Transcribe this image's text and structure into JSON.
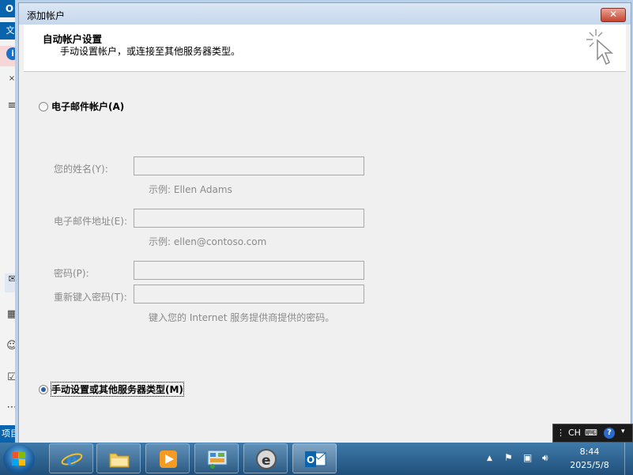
{
  "background_app": {
    "file_tab": "文",
    "items_label": "项目"
  },
  "dialog": {
    "title": "添加帐户",
    "close_label": "✕",
    "header_title": "自动帐户设置",
    "header_subtitle": "手动设置帐户，或连接至其他服务器类型。",
    "email_account_option": "电子邮件帐户(A)",
    "name_label": "您的姓名(Y):",
    "name_value": "",
    "name_hint": "示例: Ellen Adams",
    "email_label": "电子邮件地址(E):",
    "email_value": "",
    "email_hint": "示例: ellen@contoso.com",
    "password_label": "密码(P):",
    "password_value": "",
    "retype_label": "重新键入密码(T):",
    "retype_value": "",
    "password_hint": "键入您的 Internet 服务提供商提供的密码。",
    "manual_option": "手动设置或其他服务器类型(M)",
    "selected_option": "manual"
  },
  "language_bar": {
    "lang": "CH",
    "help": "?"
  },
  "taskbar": {
    "apps": [
      {
        "name": "internet-explorer",
        "active": false
      },
      {
        "name": "file-explorer",
        "active": false
      },
      {
        "name": "media-player",
        "active": false
      },
      {
        "name": "control-panel",
        "active": false
      },
      {
        "name": "browser-e",
        "active": false
      },
      {
        "name": "outlook",
        "active": true
      }
    ],
    "time": "8:44",
    "date": "2025/5/8"
  },
  "colors": {
    "accent": "#0a64ad",
    "dialog_bg": "#f0f0f0",
    "disabled_text": "#8a8a8a"
  }
}
